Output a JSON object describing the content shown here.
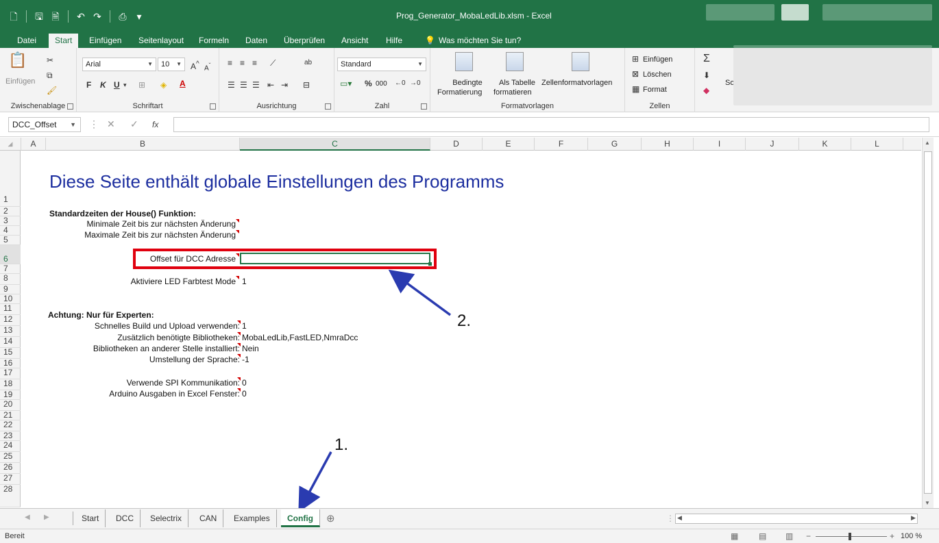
{
  "window": {
    "title": "Prog_Generator_MobaLedLib.xlsm - Excel"
  },
  "menu_tabs": [
    "Datei",
    "Start",
    "Einfügen",
    "Seitenlayout",
    "Formeln",
    "Daten",
    "Überprüfen",
    "Ansicht",
    "Hilfe",
    "Was möchten Sie tun?"
  ],
  "ribbon": {
    "clipboard": {
      "paste_label": "Einfügen",
      "group_label": "Zwischenablage"
    },
    "font": {
      "name": "Arial",
      "size": "10",
      "bold": "F",
      "italic": "K",
      "underline": "U",
      "group_label": "Schriftart"
    },
    "alignment": {
      "group_label": "Ausrichtung"
    },
    "number": {
      "format": "Standard",
      "percent": "%",
      "thousands": "000",
      "group_label": "Zahl"
    },
    "styles": {
      "conditional_label_1": "Bedingte",
      "conditional_label_2": "Formatierung",
      "table_label_1": "Als Tabelle",
      "table_label_2": "formatieren",
      "cellstyles_label": "Zellenformatvorlagen",
      "group_label": "Formatvorlagen"
    },
    "cells": {
      "insert_label": "Einfügen",
      "delete_label": "Löschen",
      "format_label": "Format",
      "group_label": "Zellen"
    },
    "editing": {
      "partial_label": "So"
    }
  },
  "formula_bar": {
    "name_box": "DCC_Offset",
    "fx": "fx",
    "value": ""
  },
  "columns": [
    "A",
    "B",
    "C",
    "D",
    "E",
    "F",
    "G",
    "H",
    "I",
    "J",
    "K",
    "L"
  ],
  "selected_column": "C",
  "rows": [
    "1",
    "2",
    "3",
    "4",
    "5",
    "6",
    "7",
    "8",
    "9",
    "10",
    "11",
    "12",
    "13",
    "14",
    "15",
    "16",
    "17",
    "18",
    "19",
    "20",
    "21",
    "22",
    "23",
    "24",
    "25",
    "26",
    "27",
    "28"
  ],
  "selected_row": "6",
  "sheet": {
    "title": "Diese Seite enthält globale Einstellungen des Programms",
    "section1_header": "Standardzeiten der House() Funktion:",
    "min_time_label": "Minimale Zeit bis zur nächsten Änderung",
    "max_time_label": "Maximale Zeit bis zur nächsten Änderung",
    "dcc_offset_label": "Offset für DCC Adresse",
    "dcc_offset_value": "",
    "led_mode_label": "Aktiviere LED Farbtest Mode",
    "led_mode_value": "1",
    "section2_header": "Achtung: Nur für Experten:",
    "fast_build_label": "Schnelles Build und Upload verwenden:",
    "fast_build_value": "1",
    "libs_label": "Zusätzlich benötigte Bibliotheken:",
    "libs_value": "MobaLedLib,FastLED,NmraDcc",
    "libs_other_label": "Bibliotheken an anderer Stelle installiert:",
    "libs_other_value": "Nein",
    "lang_label": "Umstellung der Sprache:",
    "lang_value": "-1",
    "spi_label": "Verwende SPI Kommunikation:",
    "spi_value": "0",
    "arduino_label": "Arduino Ausgaben in Excel Fenster:",
    "arduino_value": "0"
  },
  "annotations": {
    "one": "1.",
    "two": "2."
  },
  "sheet_tabs": [
    "Start",
    "DCC",
    "Selectrix",
    "CAN",
    "Examples",
    "Config"
  ],
  "active_sheet": "Config",
  "status": {
    "text": "Bereit",
    "zoom": "100 %"
  },
  "colors": {
    "excel_green": "#217346",
    "title_blue": "#1c2e9f",
    "highlight_red": "#e0000e",
    "arrow_blue": "#2a3bb0"
  }
}
